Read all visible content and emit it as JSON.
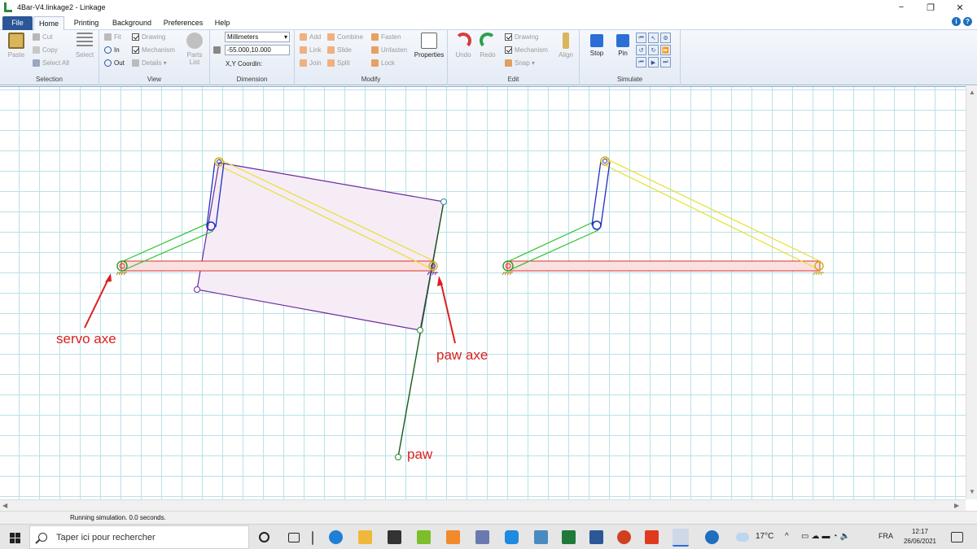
{
  "window": {
    "title": "4Bar-V4.linkage2 - Linkage",
    "controls": {
      "minimize": "−",
      "restore": "❐",
      "close": "✕"
    }
  },
  "tabs": [
    "File",
    "Home",
    "Printing",
    "Background",
    "Preferences",
    "Help"
  ],
  "ribbon": {
    "selection": {
      "label": "Selection",
      "paste": "Paste",
      "cut": "Cut",
      "copy": "Copy",
      "select_all": "Select All",
      "select": "Select"
    },
    "view": {
      "label": "View",
      "fit": "Fit",
      "in": "In",
      "out": "Out",
      "drawing": "Drawing",
      "mechanism": "Mechanism",
      "details": "Details ▾",
      "parts_list": "Parts List"
    },
    "dimension": {
      "label": "Dimension",
      "unit": "Millimeters",
      "coords": "-55.000,10.000",
      "coord_label": "X,Y Coordin:"
    },
    "modify": {
      "label": "Modify",
      "add": "Add",
      "link": "Link",
      "join": "Join",
      "combine": "Combine",
      "slide": "Slide",
      "split": "Split",
      "fasten": "Fasten",
      "unfasten": "Unfasten",
      "lock": "Lock",
      "properties": "Properties"
    },
    "edit": {
      "label": "Edit",
      "undo": "Undo",
      "redo": "Redo",
      "drawing": "Drawing",
      "mechanism": "Mechanism",
      "snap": "Snap ▾",
      "align": "Align"
    },
    "simulate": {
      "label": "Simulate",
      "stop": "Stop",
      "pin": "Pin"
    }
  },
  "canvas": {
    "annotations": {
      "servo_axe": "servo axe",
      "paw_axe": "paw axe",
      "paw": "paw"
    },
    "colors": {
      "grid": "#b7e3e8",
      "ground_link": "#e03030",
      "crank": "#30c030",
      "coupler": "#e8e030",
      "rocker": "#2030c0",
      "plate": "#6a2aa0",
      "paw_link": "#1a6a1a",
      "annotation": "#dd2020"
    }
  },
  "status": {
    "text": "Running simulation. 0.0 seconds."
  },
  "taskbar": {
    "search_placeholder": "Taper ici pour rechercher",
    "weather": "17°C",
    "language": "FRA",
    "time": "12:17",
    "date": "26/06/2021"
  }
}
